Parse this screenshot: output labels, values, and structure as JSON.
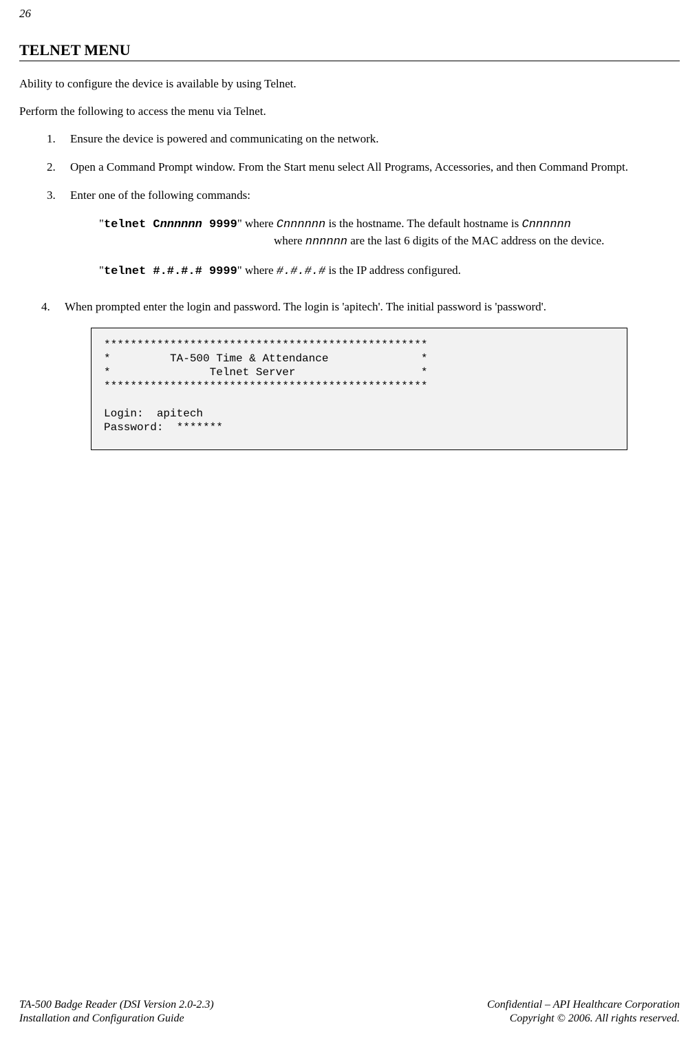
{
  "pageNumber": "26",
  "sectionTitle": "TELNET MENU",
  "intro1": "Ability to configure the device is available by using Telnet.",
  "intro2": "Perform the following to access the menu via Telnet.",
  "steps": {
    "s1": {
      "num": "1.",
      "text": "Ensure the device is powered and communicating on the network."
    },
    "s2": {
      "num": "2.",
      "text": "Open a Command Prompt window.  From the Start menu select All Programs, Accessories, and then Command Prompt."
    },
    "s3": {
      "num": "3.",
      "text": " Enter one of the following commands:"
    },
    "s4": {
      "num": "4.",
      "text": "When prompted enter the login and password.  The login is 'apitech'.  The initial password is 'password'."
    }
  },
  "cmd1": {
    "q1": "\"",
    "cmd": "telnet C",
    "cmdI": "nnnnnn",
    "cmdPort": " 9999",
    "q2": "\" where ",
    "var1a": "C",
    "var1b": "nnnnnn",
    "after1": " is the hostname.  The default hostname is ",
    "var2a": "C",
    "var2b": "nnnnnn",
    "line2a": "where ",
    "line2var": "nnnnnn",
    "line2b": " are the last 6 digits of the MAC address on the device."
  },
  "cmd2": {
    "q1": "\"",
    "cmd": "telnet #.#.#.# 9999",
    "q2": "\" where ",
    "var": "#.#.#.#",
    "after": "  is the IP address configured."
  },
  "terminal": "*************************************************\n*         TA-500 Time & Attendance              *\n*               Telnet Server                   *\n*************************************************\n\nLogin:  apitech\nPassword:  *******",
  "footer": {
    "leftLine1": "TA-500 Badge Reader (DSI Version 2.0-2.3)",
    "leftLine2": "Installation and Configuration Guide",
    "rightLine1": "Confidential – API Healthcare Corporation",
    "rightLine2": "Copyright © 2006.  All rights reserved."
  }
}
